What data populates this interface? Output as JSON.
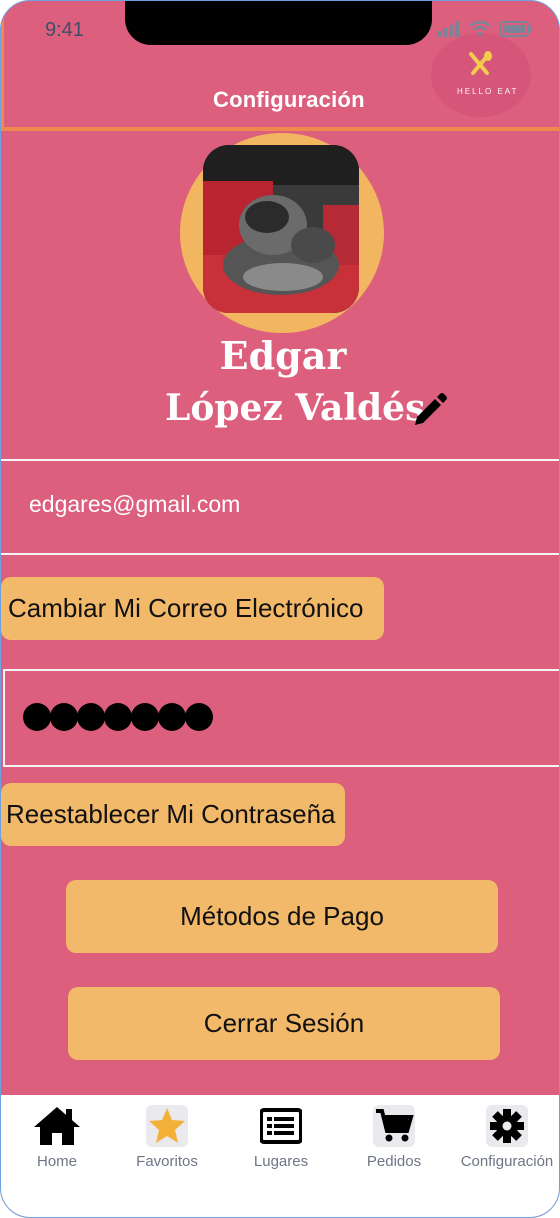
{
  "status": {
    "time": "9:41"
  },
  "header": {
    "title": "Configuración",
    "logo_text": "HELLO EAT"
  },
  "profile": {
    "first_name": "Edgar",
    "last_name": "López Valdés"
  },
  "email": {
    "value": "edgares@gmail.com",
    "change_button": "Cambiar Mi Correo Electrónico"
  },
  "password": {
    "masked_count": 7,
    "reset_button": "Reestablecer Mi Contraseña"
  },
  "actions": {
    "payment_methods": "Métodos de Pago",
    "logout": "Cerrar Sesión"
  },
  "tabs": [
    {
      "label": "Home",
      "icon": "home-icon"
    },
    {
      "label": "Favoritos",
      "icon": "star-icon"
    },
    {
      "label": "Lugares",
      "icon": "list-icon"
    },
    {
      "label": "Pedidos",
      "icon": "cart-icon"
    },
    {
      "label": "Configuración",
      "icon": "gear-icon"
    }
  ],
  "colors": {
    "background": "#dc5f7d",
    "accent": "#f3b96a",
    "header_border": "#f0894e"
  }
}
